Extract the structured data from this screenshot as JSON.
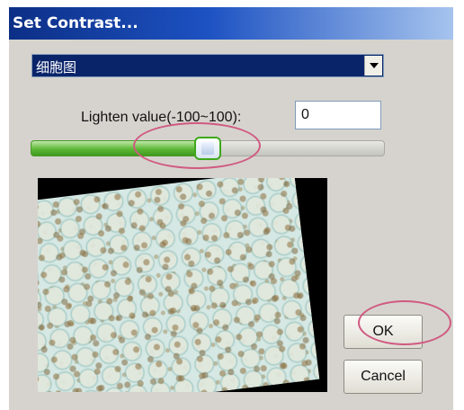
{
  "window": {
    "title": "Set Contrast..."
  },
  "dropdown": {
    "selected": "细胞图",
    "arrow_icon": "chevron-down-icon"
  },
  "lighten": {
    "label": "Lighten value(-100~100):",
    "value": "0",
    "slider_position_percent": 50
  },
  "preview": {
    "description_icon": "cell-micrograph-image"
  },
  "buttons": {
    "ok_label": "OK",
    "cancel_label": "Cancel"
  },
  "colors": {
    "title_bar_start": "#0c2f86",
    "title_bar_end": "#a6c4ee",
    "dialog_bg": "#d6d3ce",
    "slider_fill": "#5db836",
    "highlight_ring": "#d05a82"
  }
}
